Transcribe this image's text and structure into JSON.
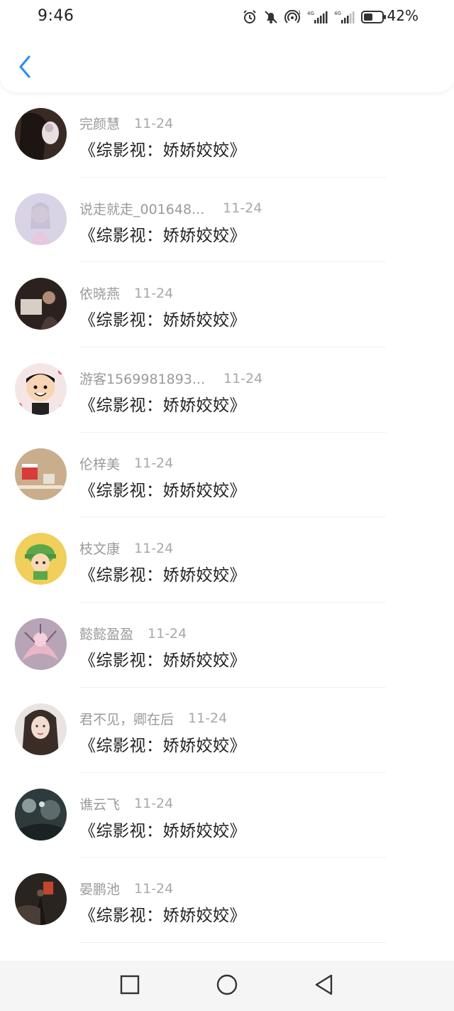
{
  "status_bar": {
    "time": "9:46",
    "battery_percent": "42%",
    "signal_1_label": "4G",
    "signal_2_label": "4G",
    "icons": [
      "alarm-icon",
      "mute-icon",
      "hotspot-icon",
      "signal-icon",
      "signal-icon",
      "battery-icon"
    ]
  },
  "header": {
    "back_icon": "chevron-left-icon",
    "accent_color": "#2f8ff0"
  },
  "list": [
    {
      "author": "完颜慧",
      "date": "11-24",
      "title": "《综影视：娇娇姣姣》"
    },
    {
      "author": "说走就走_001648...",
      "date": "11-24",
      "title": "《综影视：娇娇姣姣》"
    },
    {
      "author": "依晓燕",
      "date": "11-24",
      "title": "《综影视：娇娇姣姣》"
    },
    {
      "author": "游客1569981893...",
      "date": "11-24",
      "title": "《综影视：娇娇姣姣》"
    },
    {
      "author": "伦梓美",
      "date": "11-24",
      "title": "《综影视：娇娇姣姣》"
    },
    {
      "author": "枝文康",
      "date": "11-24",
      "title": "《综影视：娇娇姣姣》"
    },
    {
      "author": "懿懿盈盈",
      "date": "11-24",
      "title": "《综影视：娇娇姣姣》"
    },
    {
      "author": "君不见，卿在后",
      "date": "11-24",
      "title": "《综影视：娇娇姣姣》"
    },
    {
      "author": "谯云飞",
      "date": "11-24",
      "title": "《综影视：娇娇姣姣》"
    },
    {
      "author": "晏鹏池",
      "date": "11-24",
      "title": "《综影视：娇娇姣姣》"
    }
  ],
  "nav_bar": {
    "icons": [
      "recents-square-icon",
      "home-circle-icon",
      "back-triangle-icon"
    ]
  }
}
